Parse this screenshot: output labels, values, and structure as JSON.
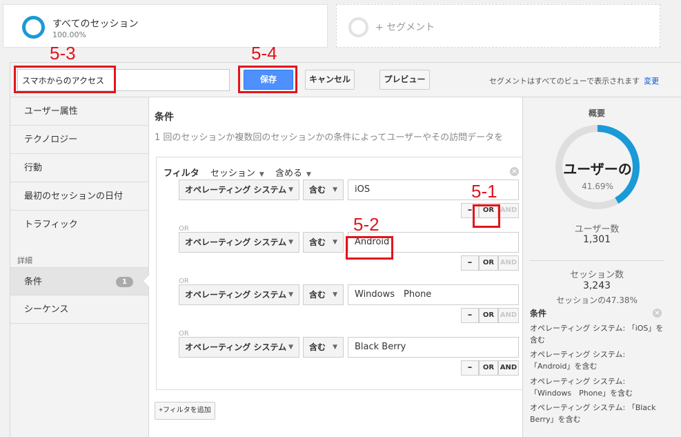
{
  "segments": {
    "active": {
      "title": "すべてのセッション",
      "percent": "100.00%"
    },
    "add_label": "+ セグメント"
  },
  "toolbar": {
    "segment_name": "スマホからのアクセス",
    "save_label": "保存",
    "cancel_label": "キャンセル",
    "preview_label": "プレビュー",
    "note": "セグメントはすべてのビューで表示されます",
    "change_link": "変更"
  },
  "sidebar": {
    "items": [
      {
        "label": "ユーザー属性"
      },
      {
        "label": "テクノロジー"
      },
      {
        "label": "行動"
      },
      {
        "label": "最初のセッションの日付"
      },
      {
        "label": "トラフィック"
      }
    ],
    "section_label": "詳細",
    "advanced": [
      {
        "label": "条件",
        "badge": "1"
      },
      {
        "label": "シーケンス"
      }
    ]
  },
  "main": {
    "title": "条件",
    "description": "1 回のセッションか複数回のセッションかの条件によってユーザーやその訪問データを",
    "filter": {
      "label": "フィルタ",
      "scope": "セッション",
      "mode": "含める",
      "or_label": "OR",
      "rows": [
        {
          "dimension": "オペレーティング システム",
          "operator": "含む",
          "value": "iOS",
          "minus": "–",
          "or": "OR",
          "and": "AND"
        },
        {
          "dimension": "オペレーティング システム",
          "operator": "含む",
          "value": "Android",
          "minus": "–",
          "or": "OR",
          "and": "AND"
        },
        {
          "dimension": "オペレーティング システム",
          "operator": "含む",
          "value": "Windows　Phone",
          "minus": "–",
          "or": "OR",
          "and": "AND"
        },
        {
          "dimension": "オペレーティング システム",
          "operator": "含む",
          "value": "Black Berry",
          "minus": "–",
          "or": "OR",
          "and": "AND"
        }
      ]
    },
    "add_filter_label": "+フィルタを追加"
  },
  "summary": {
    "title": "概要",
    "donut_label": "ユーザーの",
    "donut_percent": "41.69%",
    "donut_fraction": 0.4169,
    "users_label": "ユーザー数",
    "users_value": "1,301",
    "sessions_label": "セッション数",
    "sessions_value": "3,243",
    "sessions_share": "セッションの47.38%",
    "conditions_title": "条件",
    "conditions": [
      "オペレーティング システム: 「iOS」を含む",
      "オペレーティング システム: 「Android」を含む",
      "オペレーティング システム: 「Windows　Phone」を含む",
      "オペレーティング システム: 「Black Berry」を含む"
    ]
  },
  "annotations": [
    "5-3",
    "5-4",
    "5-1",
    "5-2"
  ],
  "colors": {
    "accent": "#1a9ad6",
    "save": "#4d90fe",
    "annotation": "#e3141b"
  },
  "icons": {
    "close": "close-icon",
    "caret": "chevron-down-icon"
  }
}
